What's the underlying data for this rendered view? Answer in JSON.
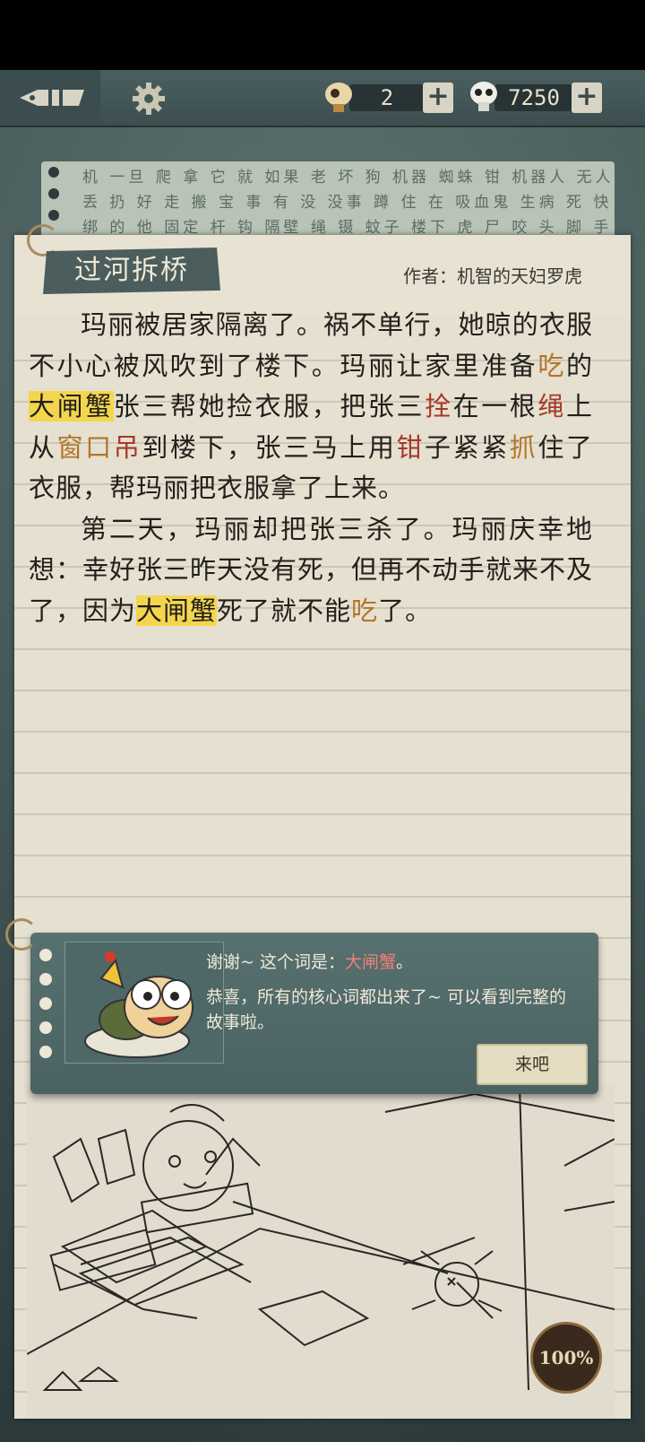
{
  "topbar": {
    "currency1_value": "2",
    "currency2_value": "7250",
    "plus_label": "+"
  },
  "word_strip": {
    "rows": [
      "机 一旦 爬 拿 它 就 如果 老 坏 狗 机器 蜘蛛 钳 机器人 无人机",
      "丢 扔 好 走 搬 宝 事 有 没 没事 蹲 住 在 吸血鬼 生病 死 快 省",
      "绑 的 他 固定 杆 钩 隔壁 绳 镊 蚊子 楼下 虎 尸 咬 头 脚 手 伸"
    ]
  },
  "story": {
    "title": "过河拆桥",
    "author": "作者：机智的天妇罗虎",
    "p1": {
      "a": "玛丽被居家隔离了。祸不单行，她晾的衣服不小心被风吹到了楼下。玛丽让家里准备",
      "b": "吃",
      "c": "的",
      "d": "大闸蟹",
      "e": "张三帮她捡衣服，把张三",
      "f": "拴",
      "g": "在一根",
      "h": "绳",
      "i": "上从",
      "j": "窗口",
      "k": "吊",
      "l": "到楼下，张三马上用",
      "m": "钳",
      "n": "子紧紧",
      "o": "抓",
      "p": "住了衣服，帮玛丽把衣服拿了上来。"
    },
    "p2": {
      "a": "第二天，玛丽却把张三杀了。玛丽庆幸地想：幸好张三昨天没有死，但再不动手就来不及了，因为",
      "b": "大闸蟹",
      "c": "死了就不能",
      "d": "吃",
      "e": "了。"
    }
  },
  "dialog": {
    "line1_prefix": "谢谢~ 这个词是：",
    "line1_keyword": "大闸蟹",
    "line1_suffix": "。",
    "line2": "恭喜，所有的核心词都出来了~ 可以看到完整的故事啦。",
    "button": "来吧"
  },
  "progress": "100%",
  "colors": {
    "highlight": "#f4d64e",
    "red_word": "#a43a28",
    "brown_word": "#b2752a",
    "keyword": "#ef7f79"
  },
  "icons": [
    "pen-icon",
    "gear-icon",
    "coin-icon",
    "skull-coin-icon",
    "plus-icon"
  ]
}
